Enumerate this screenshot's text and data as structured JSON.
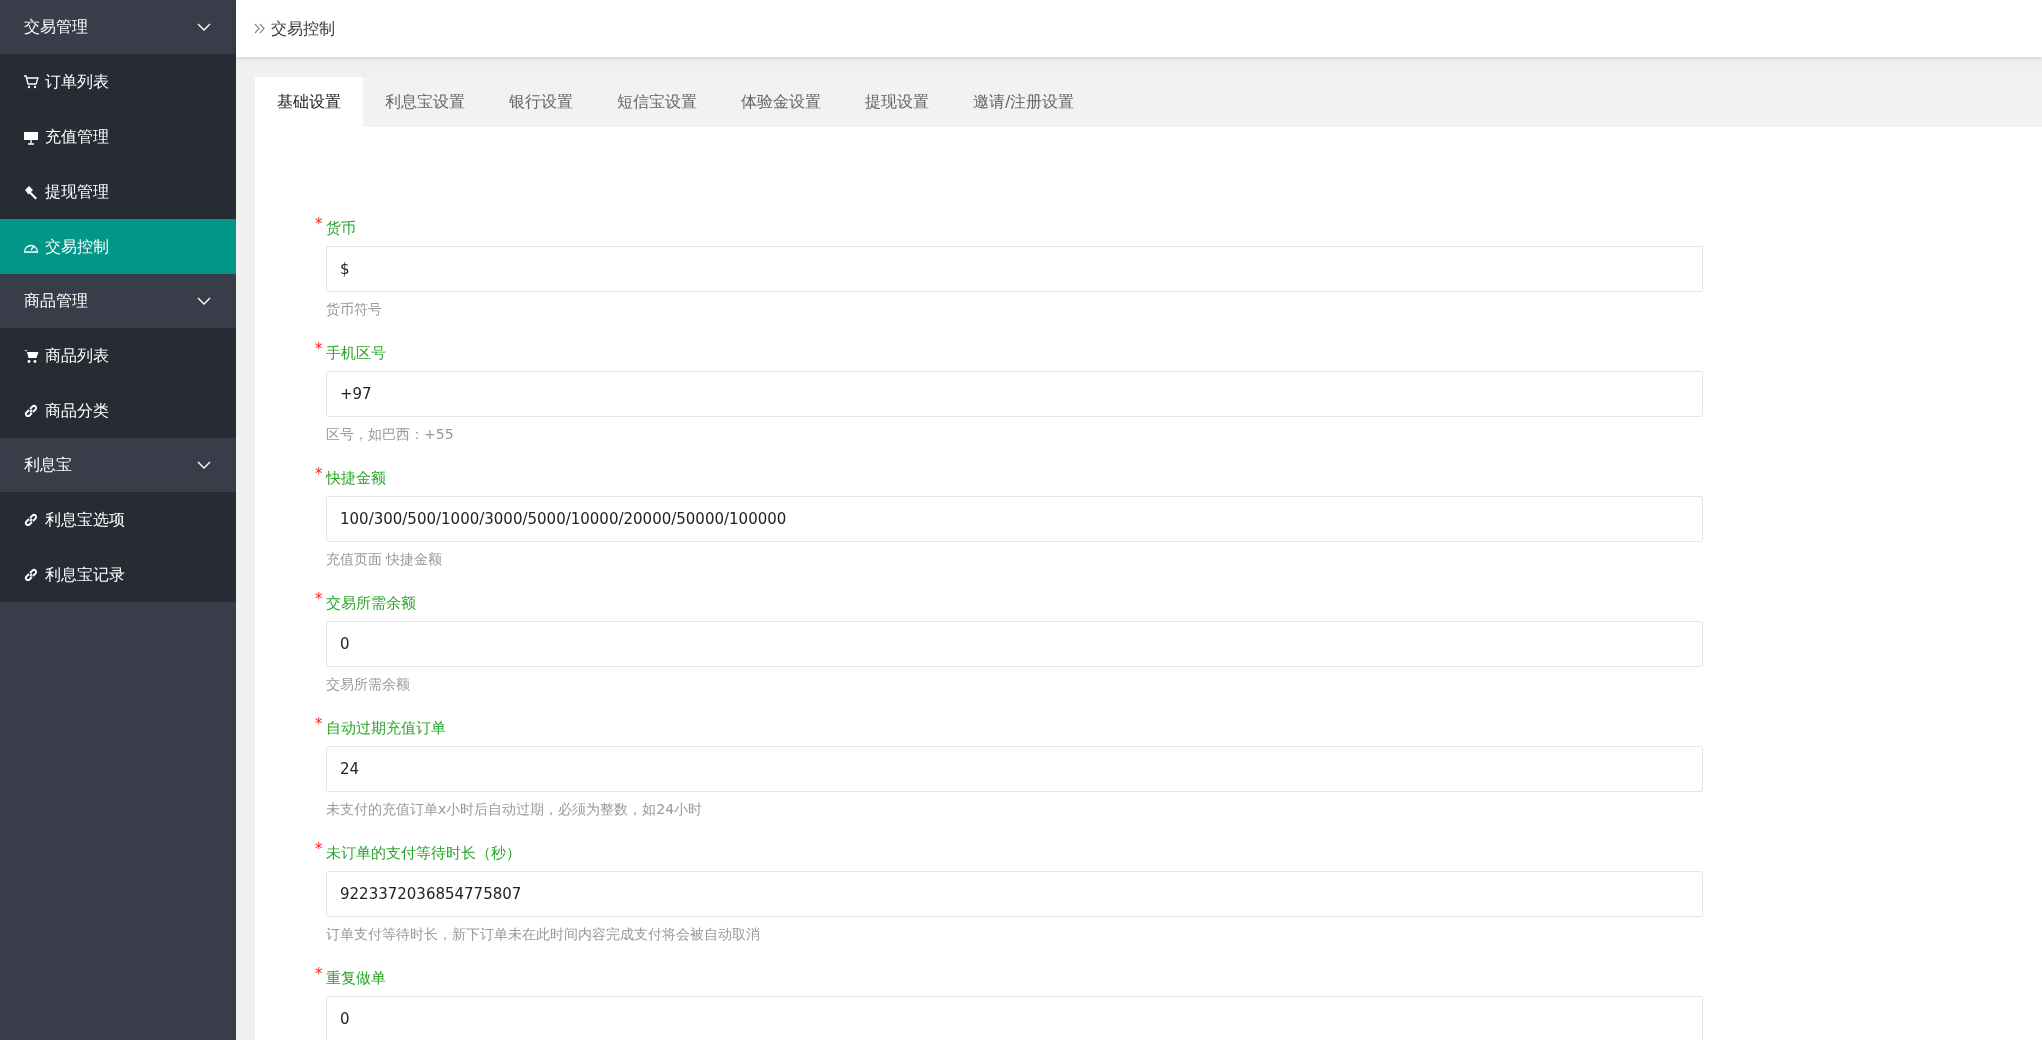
{
  "sidebar": {
    "groups": [
      {
        "label": "交易管理",
        "expanded": true,
        "items": [
          {
            "label": "订单列表",
            "kind": "cartoutline",
            "selected": false
          },
          {
            "label": "充值管理",
            "kind": "board",
            "selected": false
          },
          {
            "label": "提现管理",
            "kind": "hammer",
            "selected": false
          },
          {
            "label": "交易控制",
            "kind": "gauge",
            "selected": true
          }
        ]
      },
      {
        "label": "商品管理",
        "expanded": true,
        "items": [
          {
            "label": "商品列表",
            "kind": "cart",
            "selected": false
          },
          {
            "label": "商品分类",
            "kind": "link",
            "selected": false
          }
        ]
      },
      {
        "label": "利息宝",
        "expanded": true,
        "items": [
          {
            "label": "利息宝选项",
            "kind": "link",
            "selected": false
          },
          {
            "label": "利息宝记录",
            "kind": "link",
            "selected": false
          }
        ]
      }
    ]
  },
  "breadcrumb": {
    "title": "交易控制"
  },
  "tabs": [
    {
      "label": "基础设置",
      "selected": true
    },
    {
      "label": "利息宝设置",
      "selected": false
    },
    {
      "label": "银行设置",
      "selected": false
    },
    {
      "label": "短信宝设置",
      "selected": false
    },
    {
      "label": "体验金设置",
      "selected": false
    },
    {
      "label": "提现设置",
      "selected": false
    },
    {
      "label": "邀请/注册设置",
      "selected": false
    }
  ],
  "fields": [
    {
      "required_mark": "*",
      "label": "货币",
      "value": "$",
      "hint": "货币符号"
    },
    {
      "required_mark": "*",
      "label": "手机区号",
      "value": "+97",
      "hint": "区号，如巴西：+55"
    },
    {
      "required_mark": "*",
      "label": "快捷金额",
      "value": "100/300/500/1000/3000/5000/10000/20000/50000/100000",
      "hint": "充值页面 快捷金额"
    },
    {
      "required_mark": "*",
      "label": "交易所需余额",
      "value": "0",
      "hint": "交易所需余额"
    },
    {
      "required_mark": "*",
      "label": "自动过期充值订单",
      "value": "24",
      "hint": "未支付的充值订单x小时后自动过期，必须为整数，如24小时"
    },
    {
      "required_mark": "*",
      "label": "未订单的支付等待时长（秒）",
      "value": "9223372036854775807",
      "hint": "订单支付等待时长，新下订单未在此时间内容完成支付将会被自动取消"
    },
    {
      "required_mark": "*",
      "label": "重复做单",
      "value": "0"
    }
  ]
}
